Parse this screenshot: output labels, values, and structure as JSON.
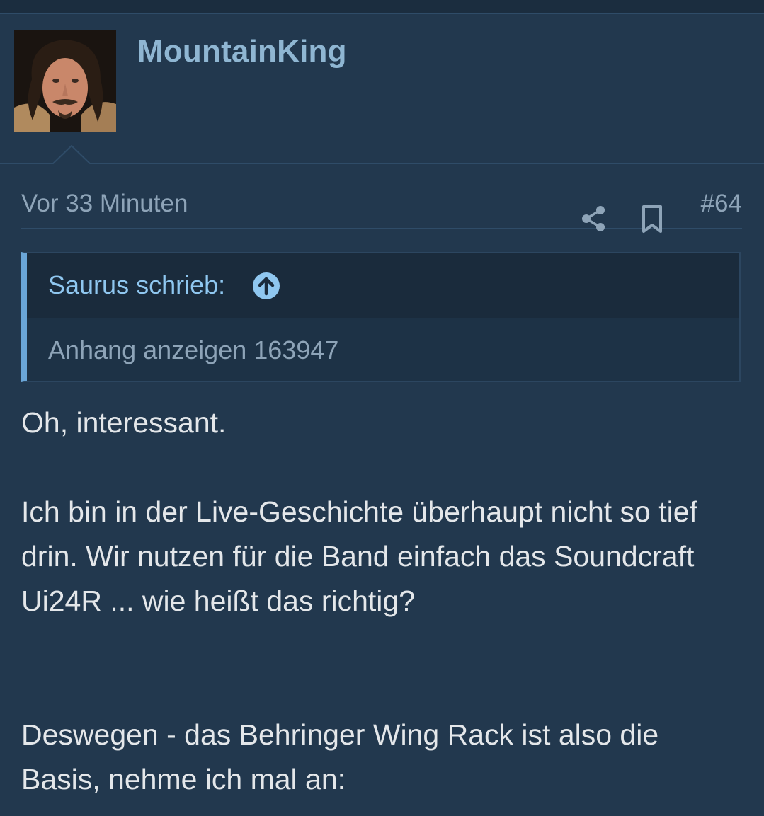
{
  "user": {
    "name": "MountainKing",
    "avatar": "user-avatar-photo"
  },
  "post": {
    "time": "Vor 33 Minuten",
    "number": "#64",
    "icons": [
      "share-icon",
      "bookmark-icon"
    ],
    "quote": {
      "author": "Saurus schrieb:",
      "icon": "arrow-up-circle-icon",
      "body": "Anhang anzeigen 163947"
    },
    "paragraphs": [
      "Oh, interessant.",
      "Ich bin in der Live-Geschichte überhaupt nicht so tief drin. Wir nutzen für die Band einfach das Soundcraft Ui24R ... wie heißt das richtig?",
      "Deswegen - das Behringer Wing Rack ist also die Basis, nehme ich mal an:"
    ]
  },
  "colors": {
    "background": "#22384e",
    "username": "#8fb6d2",
    "quote_accent": "#6aa6d8",
    "text": "#e4e7ea",
    "muted": "#8ea4b8"
  }
}
